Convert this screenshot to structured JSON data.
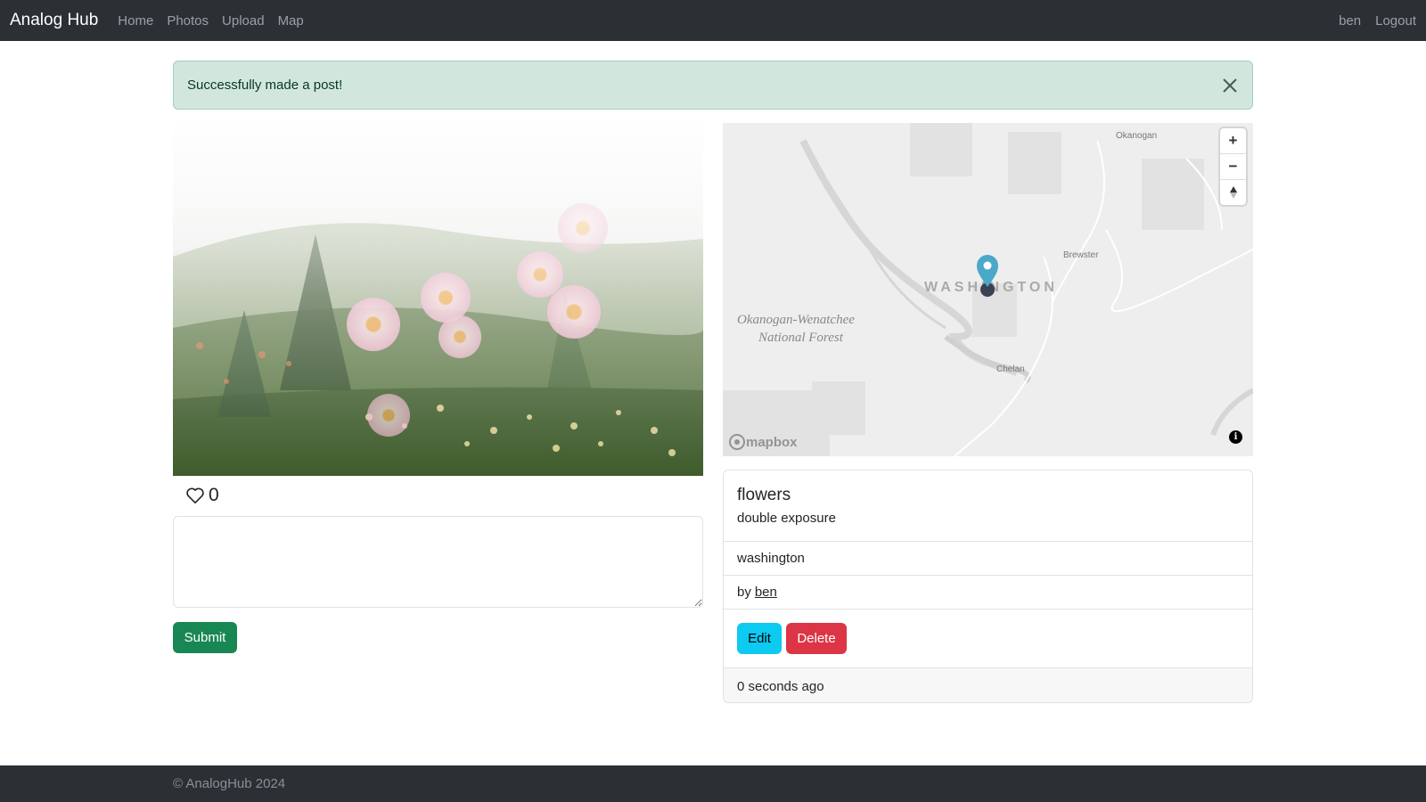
{
  "navbar": {
    "brand": "Analog Hub",
    "links": [
      "Home",
      "Photos",
      "Upload",
      "Map"
    ],
    "user": "ben",
    "logout": "Logout"
  },
  "alert": {
    "message": "Successfully made a post!"
  },
  "post": {
    "likes": "0",
    "comment_value": "",
    "submit_label": "Submit"
  },
  "map": {
    "labels": {
      "okanogan": "Okanogan",
      "brewster": "Brewster",
      "washington": "WASHINGTON",
      "forest_line1": "Okanogan-Wenatchee",
      "forest_line2": "National Forest",
      "chelan": "Chelan"
    },
    "controls": {
      "zoom_in": "+",
      "zoom_out": "−"
    },
    "attribution_logo": "mapbox",
    "info": "i",
    "marker_color": "#4aa8c8"
  },
  "card": {
    "title": "flowers",
    "description": "double exposure",
    "location": "washington",
    "by_prefix": "by",
    "author": "ben",
    "edit_label": "Edit",
    "delete_label": "Delete",
    "timestamp": "0 seconds ago"
  },
  "footer": {
    "text": "© AnalogHub 2024"
  },
  "colors": {
    "navbar": "#2b3035",
    "alert_bg": "#d1e7dd",
    "submit": "#198754",
    "edit": "#0dcaf0",
    "delete": "#dc3545"
  }
}
